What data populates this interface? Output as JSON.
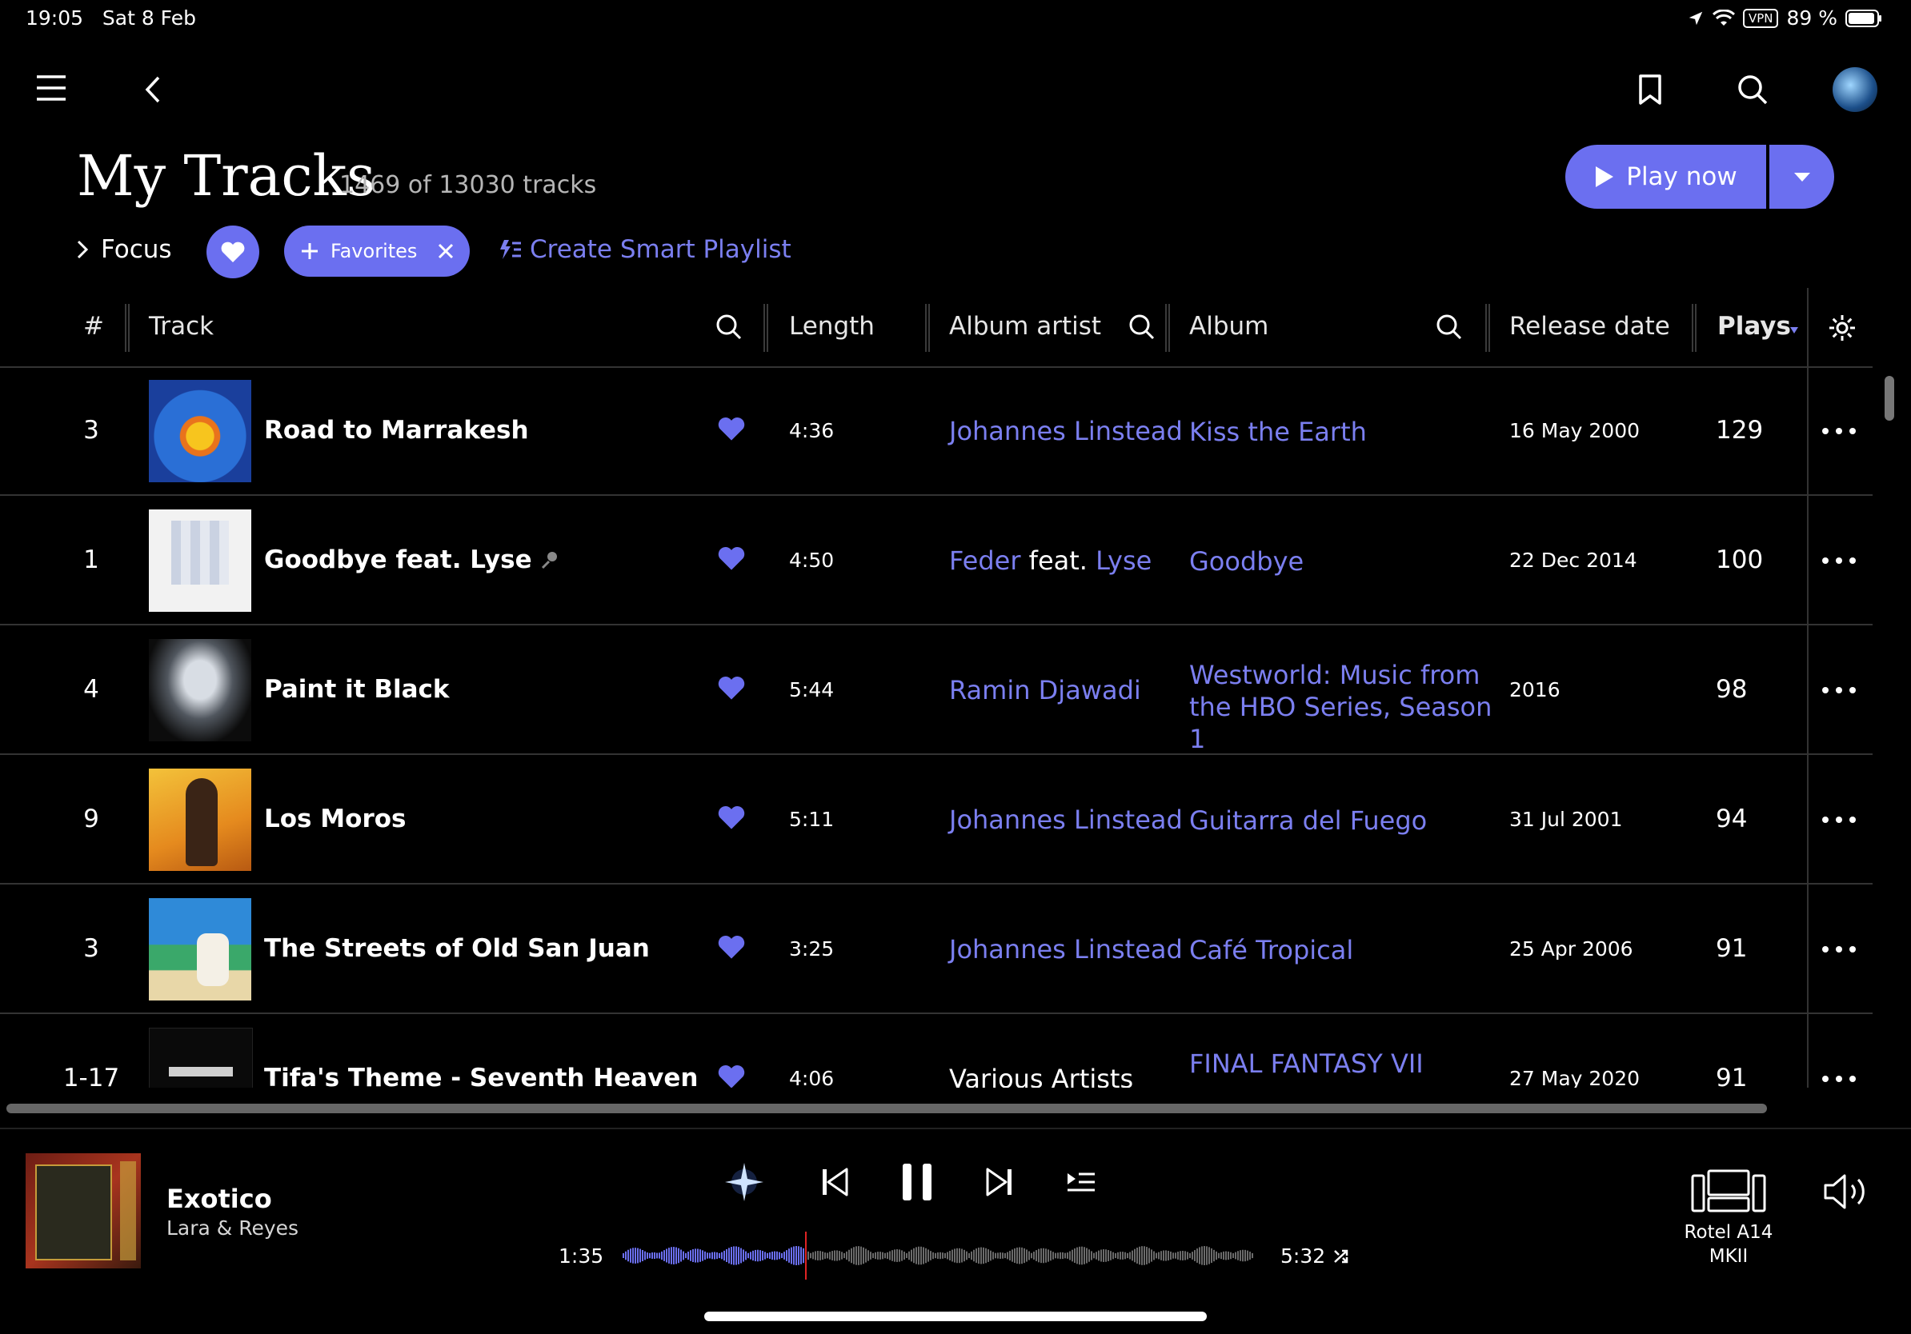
{
  "status": {
    "time": "19:05",
    "date": "Sat 8 Feb",
    "vpn": "VPN",
    "battery": "89 %"
  },
  "header": {
    "title": "My Tracks",
    "subtitle": "1469 of 13030 tracks",
    "play_label": "Play now"
  },
  "filters": {
    "focus": "Focus",
    "favorites": "Favorites",
    "smart_playlist": "Create Smart Playlist"
  },
  "columns": {
    "num": "#",
    "track": "Track",
    "length": "Length",
    "album_artist": "Album artist",
    "album": "Album",
    "release": "Release date",
    "plays": "Plays"
  },
  "tracks": [
    {
      "num": "3",
      "title": "Road to Marrakesh",
      "length": "4:36",
      "artist": "Johannes Linstead",
      "album": "Kiss the Earth",
      "release": "16 May 2000",
      "plays": "129"
    },
    {
      "num": "1",
      "title": "Goodbye feat. Lyse",
      "length": "4:50",
      "artist": "Feder",
      "artist_join": "feat.",
      "artist2": "Lyse",
      "album": "Goodbye",
      "release": "22 Dec 2014",
      "plays": "100"
    },
    {
      "num": "4",
      "title": "Paint it Black",
      "length": "5:44",
      "artist": "Ramin Djawadi",
      "album": "Westworld: Music from the HBO Series, Season 1",
      "release": "2016",
      "plays": "98"
    },
    {
      "num": "9",
      "title": "Los Moros",
      "length": "5:11",
      "artist": "Johannes Linstead",
      "album": "Guitarra del Fuego",
      "release": "31 Jul 2001",
      "plays": "94"
    },
    {
      "num": "3",
      "title": "The Streets of Old San Juan",
      "length": "3:25",
      "artist": "Johannes Linstead",
      "album": "Café Tropical",
      "release": "25 Apr 2006",
      "plays": "91"
    },
    {
      "num": "1-17",
      "title": "Tifa's Theme - Seventh Heaven",
      "length": "4:06",
      "artist": "Various Artists",
      "album": "FINAL FANTASY VII",
      "release": "27 May 2020",
      "plays": "91"
    }
  ],
  "player": {
    "title": "Exotico",
    "artist": "Lara & Reyes",
    "current": "1:35",
    "total": "5:32",
    "progress": 0.29,
    "device_line1": "Rotel A14",
    "device_line2": "MKII"
  },
  "colors": {
    "accent": "#6b6ff0",
    "link": "#7b7ff0",
    "background": "#000000"
  }
}
